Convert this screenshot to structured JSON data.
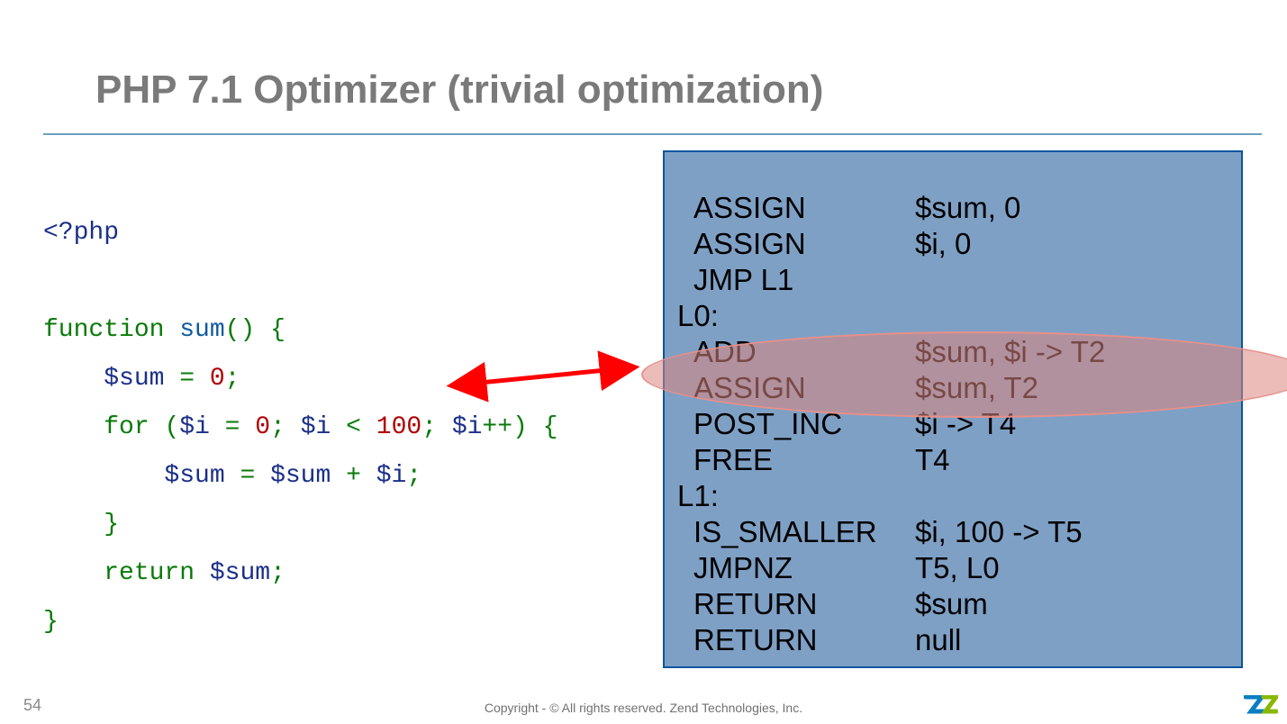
{
  "title": "PHP 7.1 Optimizer (trivial optimization)",
  "page_number": "54",
  "footer": "Copyright - © All rights reserved. Zend Technologies, Inc.",
  "code": {
    "open_tag": "<?php",
    "fn_kw": "function",
    "fn_name": "sum",
    "paren_open": "(",
    "paren_close": ")",
    "brace_open": "{",
    "brace_close": "}",
    "var_sum": "$sum",
    "var_i": "$i",
    "eq": " = ",
    "zero": "0",
    "semi": ";",
    "for_kw": "for",
    "lt": " < ",
    "hundred": "100",
    "inc": "++",
    "plus": " + ",
    "return_kw": "return"
  },
  "opcodes": [
    {
      "indent": true,
      "op": "ASSIGN",
      "args": "$sum, 0"
    },
    {
      "indent": true,
      "op": "ASSIGN",
      "args": "$i, 0"
    },
    {
      "indent": true,
      "op": "JMP L1",
      "args": ""
    },
    {
      "indent": false,
      "op": "L0:",
      "args": ""
    },
    {
      "indent": true,
      "op": "ADD",
      "args": "$sum, $i -> T2"
    },
    {
      "indent": true,
      "op": "ASSIGN",
      "args": "$sum, T2"
    },
    {
      "indent": true,
      "op": "POST_INC",
      "args": "$i -> T4"
    },
    {
      "indent": true,
      "op": "FREE",
      "args": "T4"
    },
    {
      "indent": false,
      "op": "L1:",
      "args": ""
    },
    {
      "indent": true,
      "op": "IS_SMALLER",
      "args": "$i, 100 -> T5"
    },
    {
      "indent": true,
      "op": "JMPNZ",
      "args": "T5, L0"
    },
    {
      "indent": true,
      "op": "RETURN",
      "args": "$sum"
    },
    {
      "indent": true,
      "op": "RETURN",
      "args": "null"
    }
  ]
}
